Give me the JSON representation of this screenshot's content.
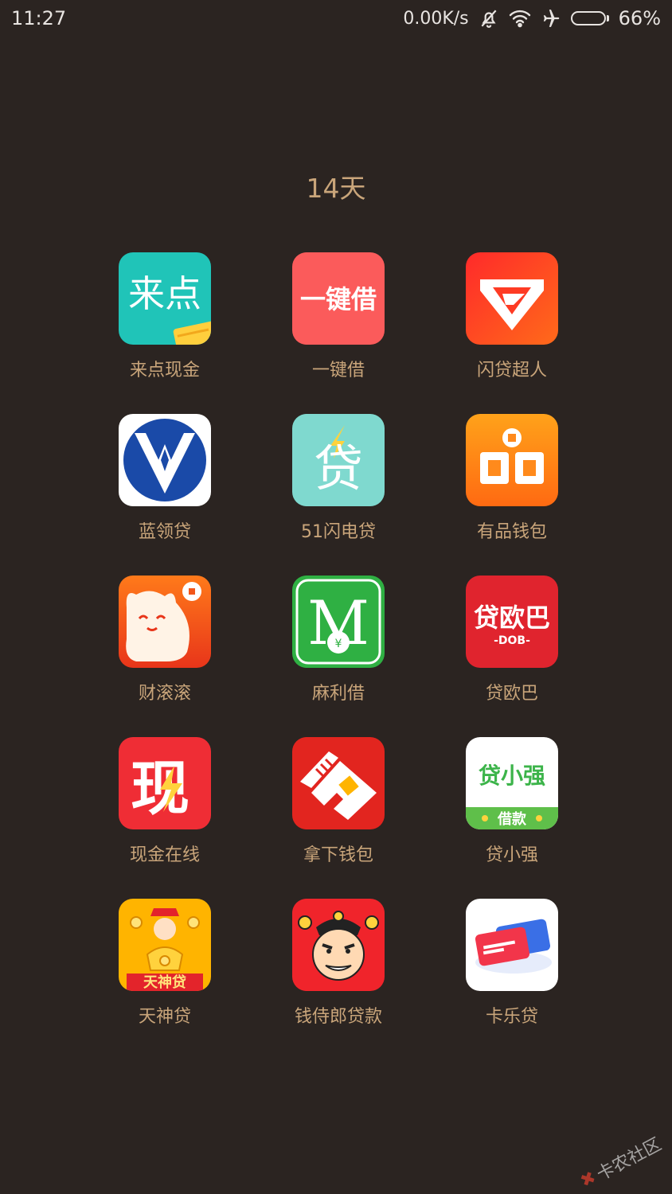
{
  "status_bar": {
    "time": "11:27",
    "net_speed": "0.00K/s",
    "battery_percent": "66%",
    "battery_level": 0.66,
    "icons": [
      "bell-off-icon",
      "wifi-icon",
      "airplane-icon",
      "battery-icon"
    ]
  },
  "folder": {
    "title": "14天"
  },
  "apps": [
    {
      "label": "来点现金",
      "icon_text": "来点",
      "bg": "#20c4b8"
    },
    {
      "label": "一键借",
      "icon_text": "一键借",
      "bg": "#fb5b5b"
    },
    {
      "label": "闪贷超人",
      "icon_text": "",
      "bg": "#fe3b24"
    },
    {
      "label": "蓝领贷",
      "icon_text": "",
      "bg": "#ffffff"
    },
    {
      "label": "51闪电贷",
      "icon_text": "贷",
      "bg": "#7fd9cf"
    },
    {
      "label": "有品钱包",
      "icon_text": "",
      "bg": "#ff8a1c"
    },
    {
      "label": "财滚滚",
      "icon_text": "",
      "bg": "#f2561a"
    },
    {
      "label": "麻利借",
      "icon_text": "M",
      "bg": "#2fb043"
    },
    {
      "label": "贷欧巴",
      "icon_text": "贷欧巴",
      "icon_subtext": "-DOB-",
      "bg": "#e0242e"
    },
    {
      "label": "现金在线",
      "icon_text": "现",
      "bg": "#ef2d35"
    },
    {
      "label": "拿下钱包",
      "icon_text": "",
      "bg": "#e2251f"
    },
    {
      "label": "贷小强",
      "icon_text": "贷小强",
      "icon_subtext": "借款",
      "bg": "#ffffff"
    },
    {
      "label": "天神贷",
      "icon_text": "天神贷",
      "bg": "#ffb400"
    },
    {
      "label": "钱侍郎贷款",
      "icon_text": "",
      "bg": "#f0242b"
    },
    {
      "label": "卡乐贷",
      "icon_text": "",
      "bg": "#ffffff"
    }
  ],
  "watermark": {
    "text": "卡农社区"
  }
}
